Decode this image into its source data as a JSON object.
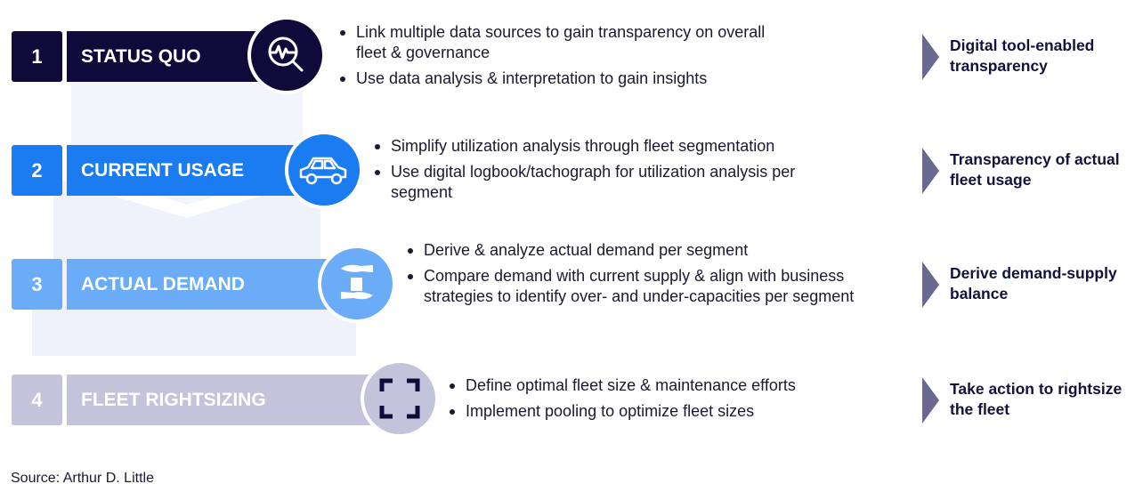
{
  "colors": {
    "step1": "#0f0a3a",
    "step2": "#1a7cf0",
    "step3": "#6aacf8",
    "step4": "#c3c3dc",
    "arrow": "#6b6890"
  },
  "steps": [
    {
      "number": "1",
      "label": "STATUS QUO",
      "icon": "magnifier-pulse-icon",
      "bullets": [
        "Link multiple data sources to gain transparency on overall fleet & governance",
        "Use data analysis & interpretation to gain insights"
      ],
      "result": "Digital tool-enabled transparency"
    },
    {
      "number": "2",
      "label": "CURRENT USAGE",
      "icon": "car-icon",
      "bullets": [
        "Simplify utilization analysis through fleet segmentation",
        "Use digital logbook/tachograph for utilization analysis per segment"
      ],
      "result": "Transparency of actual fleet usage"
    },
    {
      "number": "3",
      "label": "ACTUAL DEMAND",
      "icon": "hands-document-icon",
      "bullets": [
        "Derive & analyze actual demand per segment",
        "Compare demand with current supply & align with business strategies to identify over- and under-capacities per segment"
      ],
      "result": "Derive demand-supply balance"
    },
    {
      "number": "4",
      "label": "FLEET RIGHTSIZING",
      "icon": "resize-frame-icon",
      "bullets": [
        "Define optimal fleet size & maintenance efforts",
        "Implement pooling to optimize fleet sizes"
      ],
      "result": "Take action to rightsize the fleet"
    }
  ],
  "source": "Source: Arthur D. Little"
}
